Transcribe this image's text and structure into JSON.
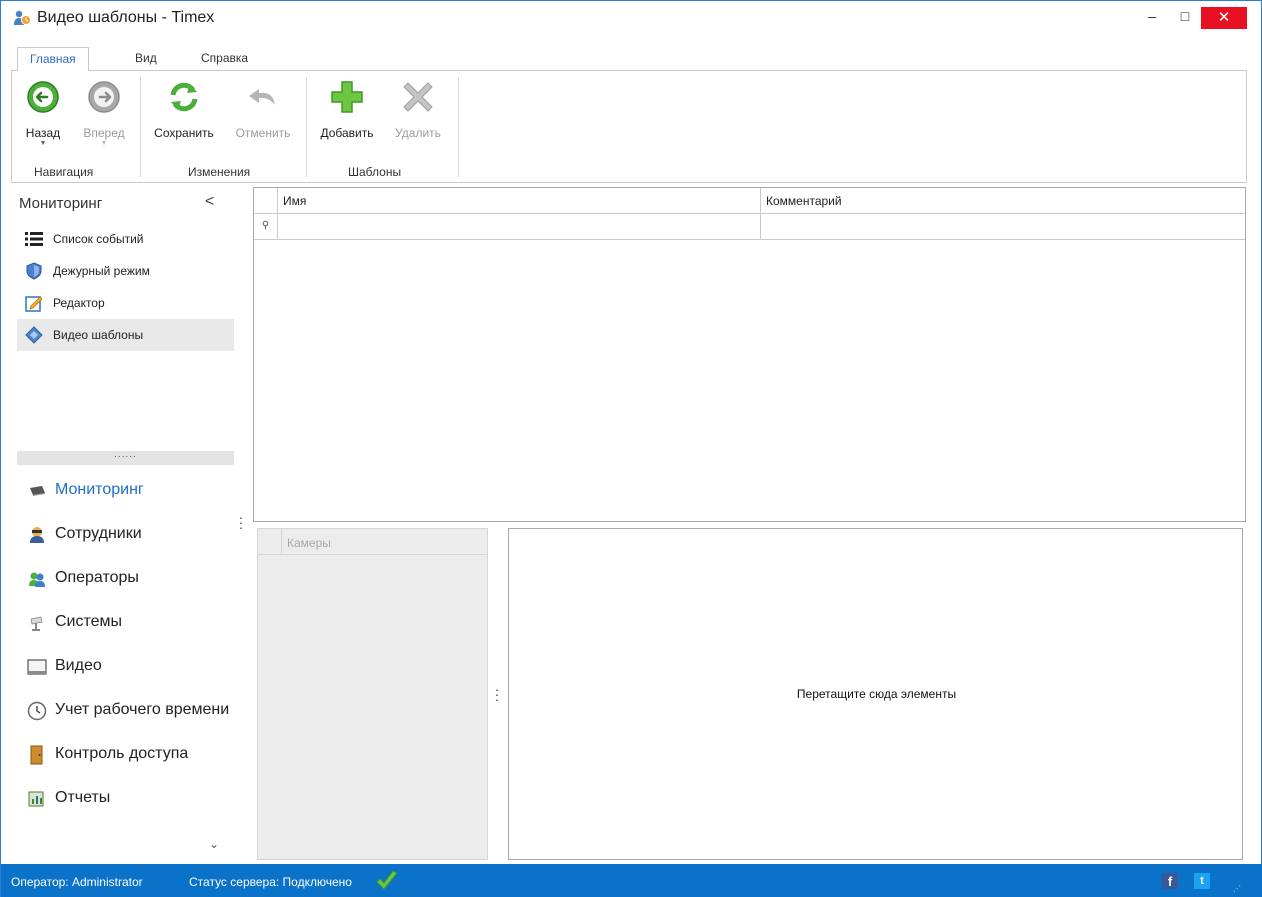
{
  "window": {
    "title": "Видео шаблоны - Timex",
    "minimize": "–",
    "maximize": "□",
    "close": "✕"
  },
  "ribbon": {
    "tabs": [
      {
        "label": "Главная",
        "active": true
      },
      {
        "label": "Вид",
        "active": false
      },
      {
        "label": "Справка",
        "active": false
      }
    ],
    "groups": {
      "navigation": "Навигация",
      "changes": "Изменения",
      "templates": "Шаблоны"
    },
    "buttons": {
      "back": "Назад",
      "forward": "Вперед",
      "save": "Сохранить",
      "cancel": "Отменить",
      "add": "Добавить",
      "delete": "Удалить"
    }
  },
  "nav": {
    "header": "Мониторинг",
    "collapse": "<",
    "items": [
      {
        "label": "Список событий",
        "icon": "list-icon"
      },
      {
        "label": "Дежурный режим",
        "icon": "shield-icon"
      },
      {
        "label": "Редактор",
        "icon": "editor-icon"
      },
      {
        "label": "Видео шаблоны",
        "icon": "video-template-icon",
        "selected": true
      }
    ],
    "splitter": "......",
    "sections": [
      {
        "label": "Мониторинг",
        "icon": "monitor-icon",
        "active": true
      },
      {
        "label": "Сотрудники",
        "icon": "employees-icon"
      },
      {
        "label": "Операторы",
        "icon": "operators-icon"
      },
      {
        "label": "Системы",
        "icon": "systems-icon"
      },
      {
        "label": "Видео",
        "icon": "video-icon"
      },
      {
        "label": "Учет рабочего времени",
        "icon": "clock-icon"
      },
      {
        "label": "Контроль доступа",
        "icon": "door-icon"
      },
      {
        "label": "Отчеты",
        "icon": "reports-icon"
      }
    ],
    "more": "⌄"
  },
  "grid": {
    "columns": [
      "Имя",
      "Комментарий"
    ],
    "filter_icon": "⚲"
  },
  "cameras": {
    "header": "Камеры"
  },
  "drop": {
    "text": "Перетащите сюда элементы"
  },
  "status": {
    "operator": "Оператор: Administrator",
    "server": "Статус сервера: Подключено",
    "facebook": "f",
    "twitter": "t",
    "grip": "⋰"
  },
  "colors": {
    "accent": "#0a72c9",
    "close": "#e81123",
    "active_tab": "#2b6cc4",
    "selected_item": "#e9e9e9"
  }
}
